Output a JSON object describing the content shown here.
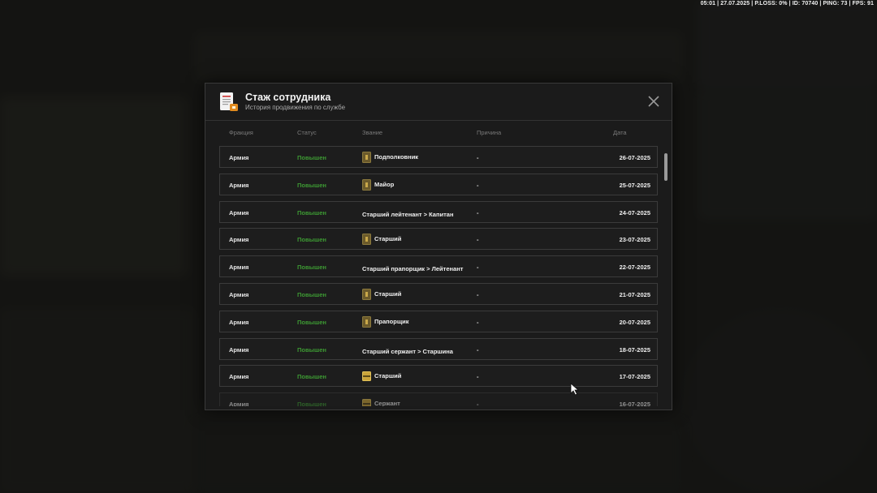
{
  "hud": {
    "stats": "05:01 | 27.07.2025 | P.LOSS: 0% | ID: 70740 | PING: 73 | FPS: 91"
  },
  "modal": {
    "title": "Стаж сотрудника",
    "subtitle": "История продвижения по службе",
    "icon": "document-badge-icon",
    "close_icon": "close-icon"
  },
  "columns": {
    "faction": "Фракция",
    "status": "Статус",
    "rank": "Звание",
    "reason": "Причина",
    "date": "Дата"
  },
  "rows": [
    {
      "faction": "Армия",
      "status": "Повышен",
      "rank": "Подполковник",
      "insignia": "bar",
      "reason": "-",
      "date": "26-07-2025"
    },
    {
      "faction": "Армия",
      "status": "Повышен",
      "rank": "Майор",
      "insignia": "bar",
      "reason": "-",
      "date": "25-07-2025"
    },
    {
      "faction": "Армия",
      "status": "Повышен",
      "rank": "Старший лейтенант > Капитан",
      "insignia": "none",
      "reason": "-",
      "date": "24-07-2025"
    },
    {
      "faction": "Армия",
      "status": "Повышен",
      "rank": "Старший",
      "insignia": "bar",
      "reason": "-",
      "date": "23-07-2025"
    },
    {
      "faction": "Армия",
      "status": "Повышен",
      "rank": "Старший прапорщик > Лейтенант",
      "insignia": "none",
      "reason": "-",
      "date": "22-07-2025"
    },
    {
      "faction": "Армия",
      "status": "Повышен",
      "rank": "Старший",
      "insignia": "bar",
      "reason": "-",
      "date": "21-07-2025"
    },
    {
      "faction": "Армия",
      "status": "Повышен",
      "rank": "Прапорщик",
      "insignia": "bar",
      "reason": "-",
      "date": "20-07-2025"
    },
    {
      "faction": "Армия",
      "status": "Повышен",
      "rank": "Старший сержант > Старшина",
      "insignia": "none",
      "reason": "-",
      "date": "18-07-2025"
    },
    {
      "faction": "Армия",
      "status": "Повышен",
      "rank": "Старший",
      "insignia": "gold",
      "reason": "-",
      "date": "17-07-2025"
    },
    {
      "faction": "Армия",
      "status": "Повышен",
      "rank": "Сержант",
      "insignia": "gold",
      "reason": "-",
      "date": "16-07-2025"
    }
  ],
  "colors": {
    "status_green": "#3d9a33",
    "modal_bg": "#1b1b1b",
    "row_border": "#3b3b3b"
  }
}
